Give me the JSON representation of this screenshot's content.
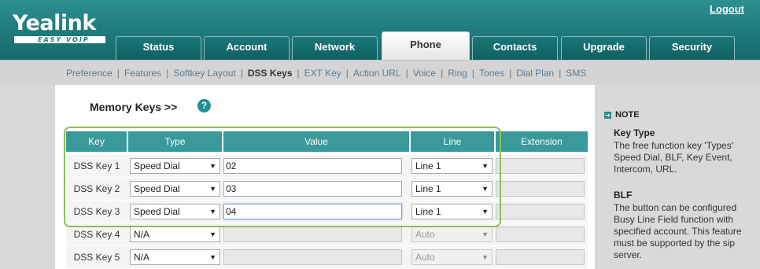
{
  "header": {
    "logo": "Yealink",
    "tagline": "EASY VOIP",
    "logout": "Logout",
    "tabs": [
      {
        "label": "Status"
      },
      {
        "label": "Account"
      },
      {
        "label": "Network"
      },
      {
        "label": "Phone",
        "active": true
      },
      {
        "label": "Contacts"
      },
      {
        "label": "Upgrade"
      },
      {
        "label": "Security"
      }
    ]
  },
  "subnav": {
    "items": [
      {
        "label": "Preference"
      },
      {
        "label": "Features"
      },
      {
        "label": "Softkey Layout"
      },
      {
        "label": "DSS Keys",
        "active": true
      },
      {
        "label": "EXT Key"
      },
      {
        "label": "Action URL"
      },
      {
        "label": "Voice"
      },
      {
        "label": "Ring"
      },
      {
        "label": "Tones"
      },
      {
        "label": "Dial Plan"
      },
      {
        "label": "SMS"
      }
    ]
  },
  "main": {
    "title": "Memory Keys >>",
    "help_icon": "?",
    "table": {
      "headers": [
        "Key",
        "Type",
        "Value",
        "Line",
        "Extension"
      ],
      "rows": [
        {
          "key": "DSS Key 1",
          "type": "Speed Dial",
          "value": "02",
          "line": "Line 1",
          "extension": ""
        },
        {
          "key": "DSS Key 2",
          "type": "Speed Dial",
          "value": "03",
          "line": "Line 1",
          "extension": ""
        },
        {
          "key": "DSS Key 3",
          "type": "Speed Dial",
          "value": "04",
          "line": "Line 1",
          "extension": ""
        },
        {
          "key": "DSS Key 4",
          "type": "N/A",
          "value": "",
          "line": "Auto",
          "extension": ""
        },
        {
          "key": "DSS Key 5",
          "type": "N/A",
          "value": "",
          "line": "Auto",
          "extension": ""
        }
      ]
    }
  },
  "note": {
    "label": "NOTE",
    "sections": [
      {
        "title": "Key Type",
        "text": "The free function key 'Types' Speed Dial, BLF, Key Event, Intercom, URL."
      },
      {
        "title": "BLF",
        "text": "The button can be configured Busy Line Field function with specified account. This feature must be supported by the sip server."
      }
    ]
  },
  "colors": {
    "header": "#1f7a7b",
    "table_header": "#3a9a9a",
    "highlight": "#8fbd56"
  }
}
